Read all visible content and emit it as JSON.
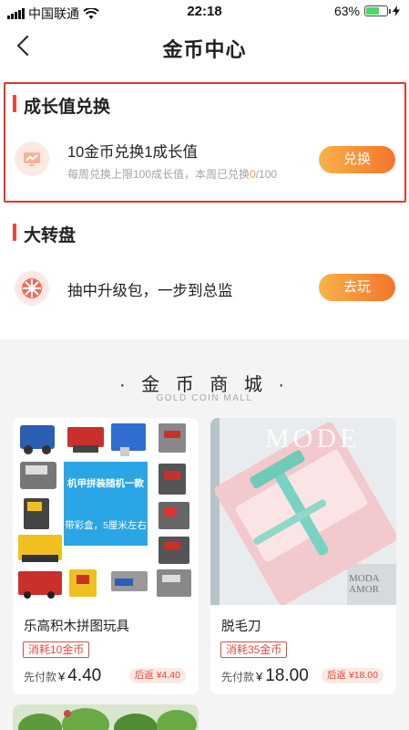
{
  "status_bar": {
    "carrier": "中国联通",
    "time": "22:18",
    "battery_percent": "63%",
    "battery_level": 0.63
  },
  "nav": {
    "title": "金币中心"
  },
  "growth": {
    "section_title": "成长值兑换",
    "item_title": "10金币兑换1成长值",
    "subtitle_prefix": "每周兑换上限100成长值，本周已兑换",
    "redeemed_count": "0",
    "subtitle_suffix": "/100",
    "button_label": "兑换"
  },
  "wheel": {
    "section_title": "大转盘",
    "item_title": "抽中升级包，一步到总监",
    "button_label": "去玩"
  },
  "mall": {
    "title": "· 金 币 商 城 ·",
    "subtitle": "GOLD COIN MALL",
    "products": [
      {
        "name": "乐高积木拼图玩具",
        "cost": "消耗10金币",
        "price_label": "先付款",
        "currency": "¥",
        "price": "4.40",
        "rebate": "后返 ¥4.40",
        "image_banner_1": "机甲拼装随机一款",
        "image_banner_2": "带彩盒，5厘米左右"
      },
      {
        "name": "脱毛刀",
        "cost": "消耗35金币",
        "price_label": "先付款",
        "currency": "¥",
        "price": "18.00",
        "rebate": "后返 ¥18.00",
        "image_text_top": "MODE",
        "image_text_bottom": "MODA AMOR"
      }
    ]
  },
  "colors": {
    "accent_red": "#e8473c",
    "button_orange": "#f3752b",
    "highlight_border": "#e5342b"
  }
}
